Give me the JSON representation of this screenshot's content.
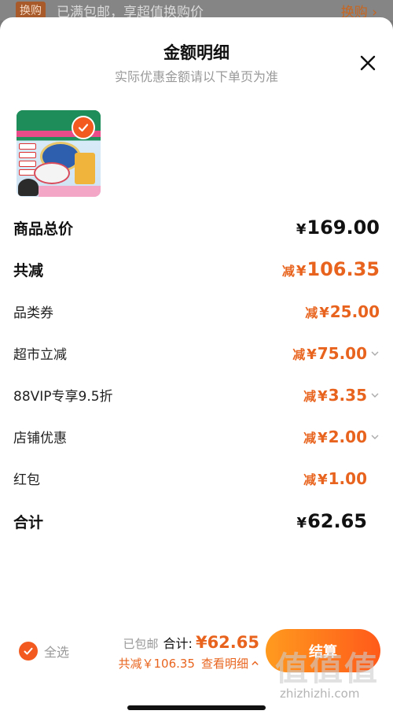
{
  "top_banner": {
    "tag": "换购",
    "text": "已满包邮，享超值换购价",
    "link": "换购 ›"
  },
  "sheet": {
    "title": "金额明细",
    "subtitle": "实际优惠金额请以下单页为准"
  },
  "rows": {
    "total_price": {
      "label": "商品总价",
      "yen": "¥",
      "value": "169.00"
    },
    "total_reduction": {
      "label": "共减",
      "minus": "减",
      "yen": "¥",
      "value": "106.35"
    },
    "category_coupon": {
      "label": "品类券",
      "minus": "减",
      "yen": "¥",
      "value": "25.00"
    },
    "market_discount": {
      "label": "超市立减",
      "minus": "减",
      "yen": "¥",
      "value": "75.00"
    },
    "vip_discount": {
      "label": "88VIP专享9.5折",
      "minus": "减",
      "yen": "¥",
      "value": "3.35"
    },
    "store_discount": {
      "label": "店铺优惠",
      "minus": "减",
      "yen": "¥",
      "value": "2.00"
    },
    "red_packet": {
      "label": "红包",
      "minus": "减",
      "yen": "¥",
      "value": "1.00"
    },
    "sum": {
      "label": "合计",
      "yen": "¥",
      "value": "62.65"
    }
  },
  "bottom_bar": {
    "select_all": "全选",
    "free_shipping": "已包邮",
    "total_label": "合计:",
    "total_value": "¥62.65",
    "reduction_text": "共减￥106.35",
    "detail_link": "查看明细",
    "checkout": "结算"
  },
  "watermark": {
    "logo": "值值值",
    "site": "zhizhizhi.com"
  },
  "colors": {
    "accent": "#e8641e",
    "checkout_start": "#ff9a1e",
    "checkout_end": "#ff5a1a",
    "check": "#f25a1f"
  }
}
